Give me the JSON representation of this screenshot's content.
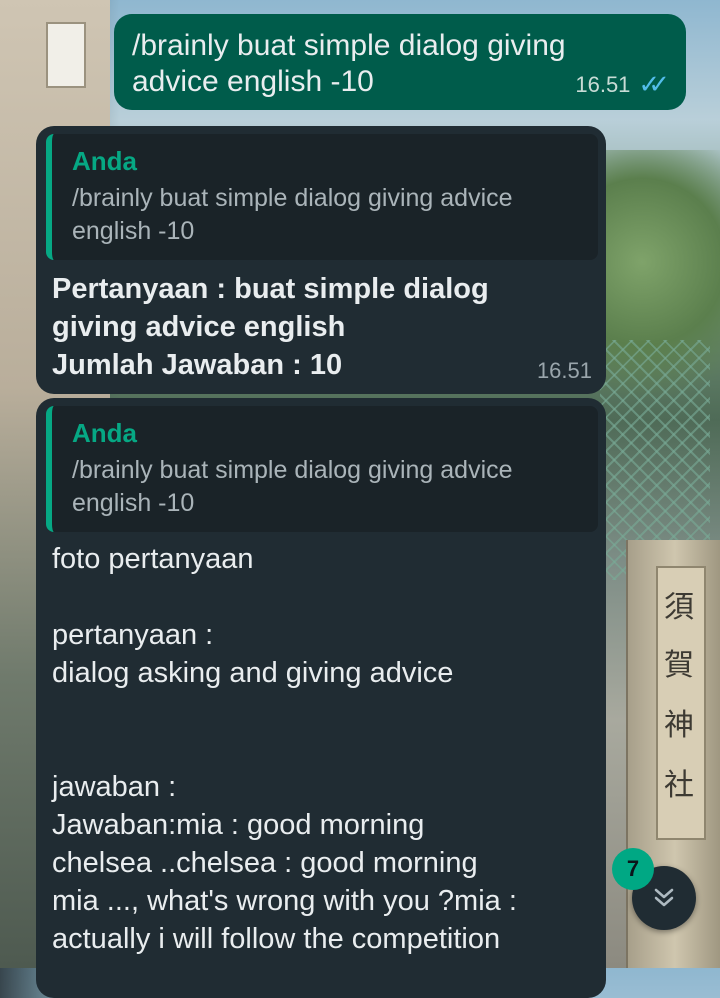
{
  "background": {
    "kanji": [
      "須",
      "賀",
      "神",
      "社"
    ]
  },
  "messages": {
    "outgoing": {
      "text": "/brainly buat simple dialog giving advice english -10",
      "time": "16.51",
      "ticks_icon": "double-check-icon",
      "ticks_color": "#53bdeb"
    },
    "reply1": {
      "quote_author": "Anda",
      "quote_text": "/brainly buat simple dialog giving advice english -10",
      "line1": "Pertanyaan : buat simple dialog",
      "line2": "giving advice english",
      "line3": "Jumlah Jawaban : 10",
      "time": "16.51"
    },
    "reply2": {
      "quote_author": "Anda",
      "quote_text": "/brainly buat simple dialog giving advice english -10",
      "body": "foto pertanyaan\n\npertanyaan :\ndialog asking and giving advice\n\n\njawaban :\nJawaban:mia : good morning\nchelsea ..chelsea : good morning\nmia ..., what's wrong with you ?mia :\nactually i will follow the competition"
    }
  },
  "scroll": {
    "unread_count": "7",
    "icon": "double-chevron-down-icon"
  },
  "colors": {
    "outgoing_bubble": "#005c4b",
    "incoming_bubble": "#202c33",
    "accent": "#06a884"
  }
}
